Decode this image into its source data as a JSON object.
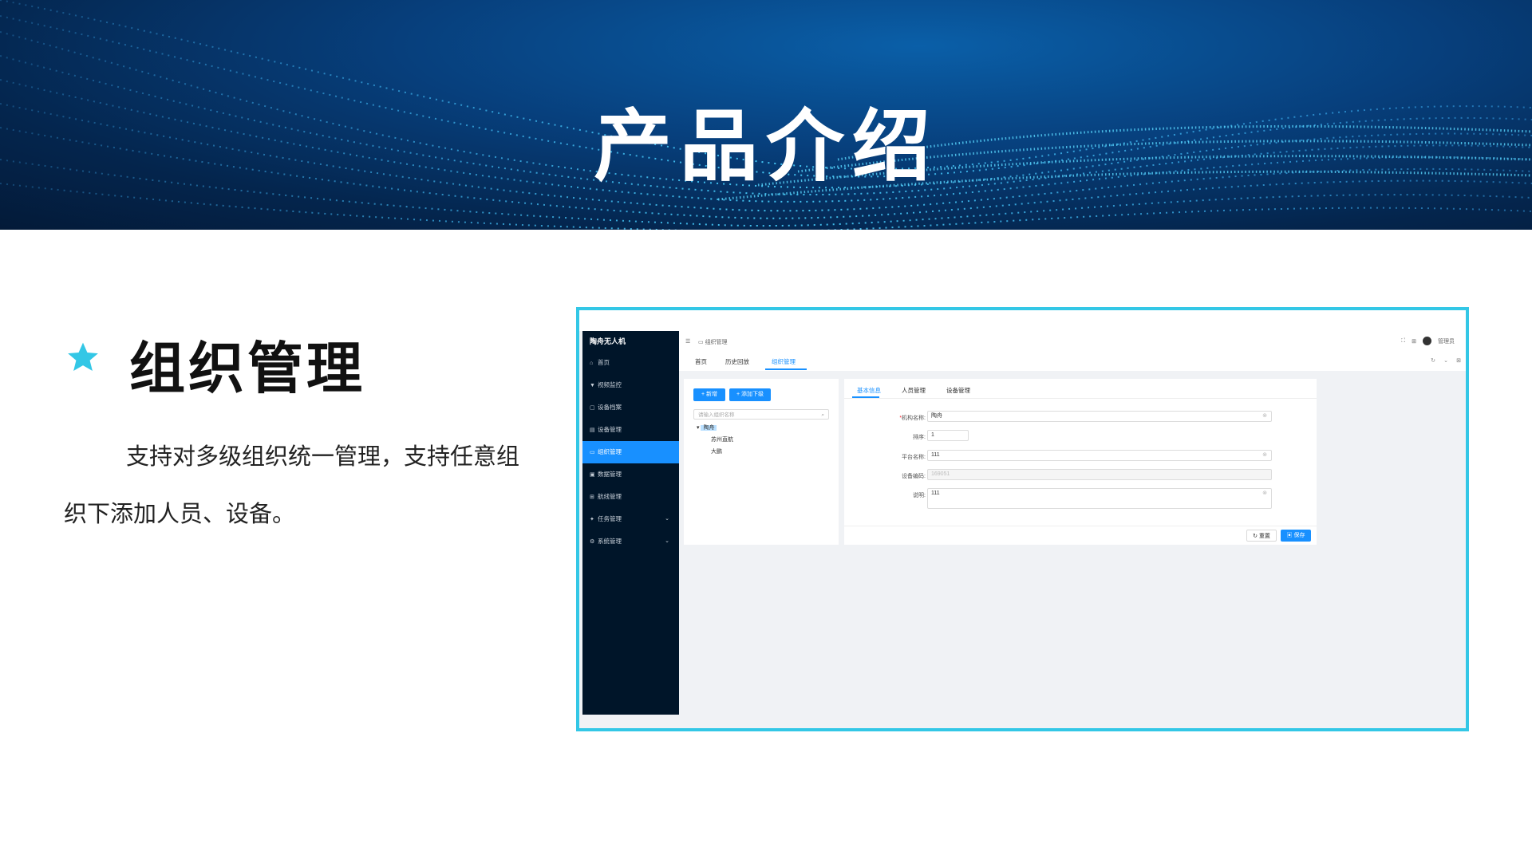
{
  "slide": {
    "banner_title": "产品介绍",
    "section_title": "组织管理",
    "description": "支持对多级组织统一管理，支持任意组织下添加人员、设备。",
    "star_icon": "star-icon",
    "colors": {
      "accent": "#33c7e6",
      "banner_dark": "#031a38",
      "banner_mid": "#0a5fa8"
    }
  },
  "app": {
    "logo": "陶舟无人机",
    "sidebar": {
      "items": [
        {
          "icon": "home-icon",
          "label": "首页"
        },
        {
          "icon": "monitor-icon",
          "label": "视频监控"
        },
        {
          "icon": "device-icon",
          "label": "设备档案"
        },
        {
          "icon": "device-manage-icon",
          "label": "设备管理"
        },
        {
          "icon": "org-icon",
          "label": "组织管理"
        },
        {
          "icon": "data-icon",
          "label": "数据管理"
        },
        {
          "icon": "route-icon",
          "label": "航线管理"
        },
        {
          "icon": "task-icon",
          "label": "任务管理"
        },
        {
          "icon": "settings-icon",
          "label": "系统管理"
        }
      ],
      "active_index": 4,
      "colors": {
        "bg": "#001529",
        "active": "#1890ff"
      }
    },
    "topbar": {
      "breadcrumb": "组织管理",
      "user_name": "管理员"
    },
    "tabs": [
      {
        "label": "首页"
      },
      {
        "label": "历史回放"
      },
      {
        "label": "组织管理"
      }
    ],
    "active_tab": 2,
    "tree": {
      "add_button": "+ 新增",
      "add_child_button": "+ 添加下级",
      "search_placeholder": "请输入组织名称",
      "nodes": [
        {
          "label": "陶舟",
          "level": 0,
          "selected": true
        },
        {
          "label": "苏州直航",
          "level": 1
        },
        {
          "label": "大鹏",
          "level": 1
        }
      ]
    },
    "form": {
      "tabs": [
        {
          "label": "基本信息"
        },
        {
          "label": "人员管理"
        },
        {
          "label": "设备管理"
        }
      ],
      "fields": {
        "org_name": {
          "label": "机构名称:",
          "value": "陶舟"
        },
        "sort": {
          "label": "排序:",
          "value": "1"
        },
        "platform_name": {
          "label": "平台名称:",
          "value": "111"
        },
        "device_code": {
          "label": "设备编码:",
          "value": "169051"
        },
        "remark": {
          "label": "说明:",
          "value": "111"
        }
      },
      "reset_button": "重置",
      "save_button": "保存"
    }
  }
}
